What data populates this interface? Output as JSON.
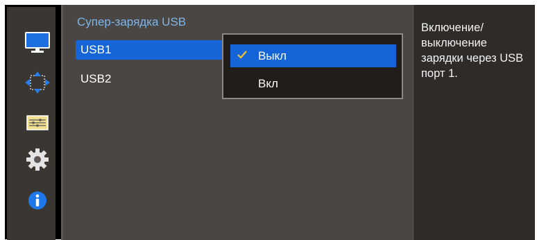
{
  "sidebar": {
    "icons": [
      "monitor-icon",
      "move-arrows-icon",
      "sliders-icon",
      "gear-icon",
      "info-icon"
    ]
  },
  "menu": {
    "title": "Супер-зарядка USB",
    "items": [
      "USB1",
      "USB2"
    ]
  },
  "dropdown": {
    "options": [
      {
        "label": "Выкл",
        "checked": true
      },
      {
        "label": "Вкл",
        "checked": false
      }
    ]
  },
  "info": {
    "text": "Включение/ выключение зарядки через USB порт 1."
  },
  "colors": {
    "accent": "#1565d8",
    "title": "#7fb6ea",
    "check": "#f5c22a"
  }
}
